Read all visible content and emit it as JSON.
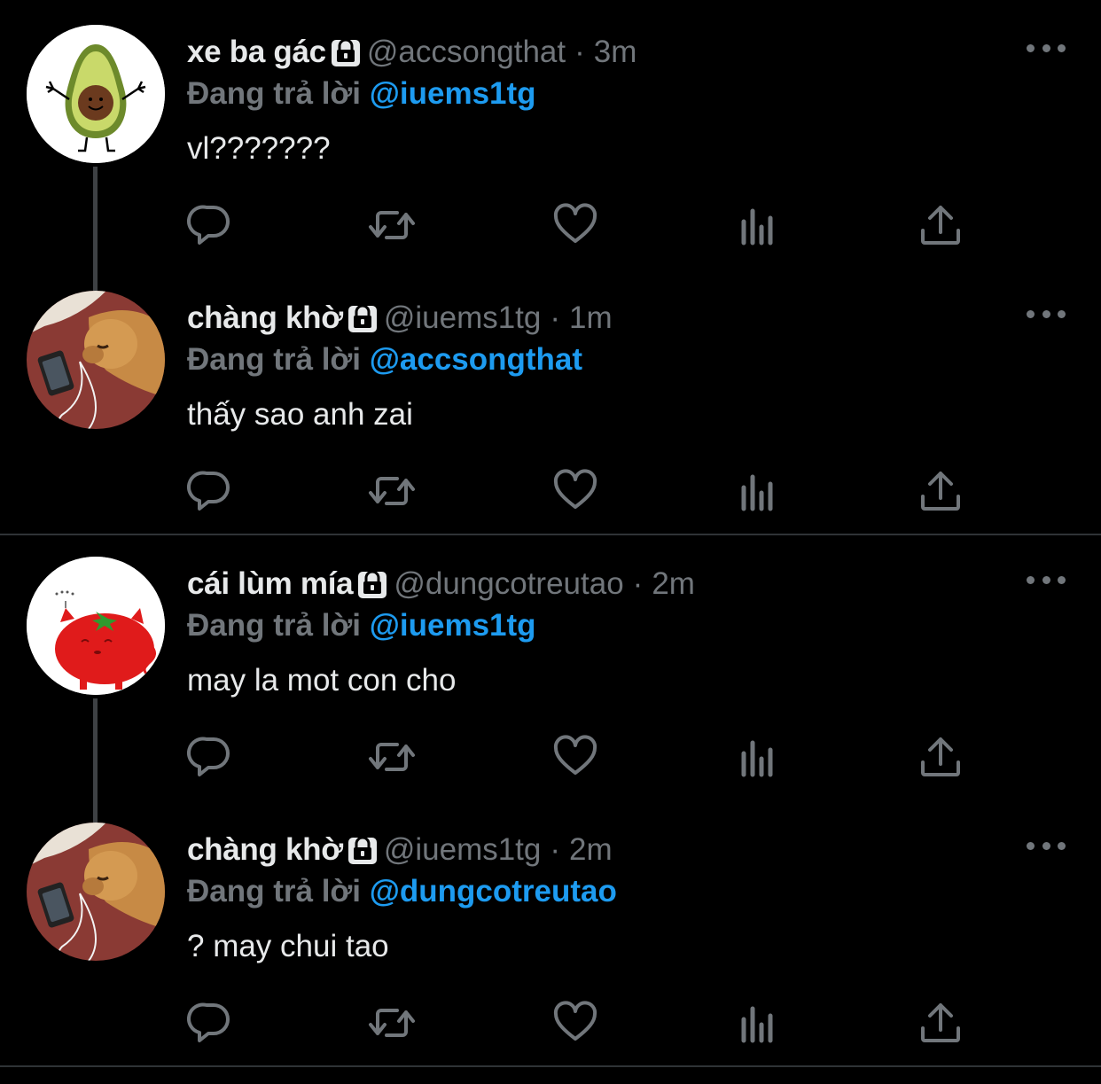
{
  "tweets": [
    {
      "name": "xe ba gác",
      "handle": "@accsongthat",
      "separator": "·",
      "time": "3m",
      "replying_label": "Đang trả lời",
      "replying_to": "@iuems1tg",
      "text": "vl???????",
      "avatar": "avocado-avatar"
    },
    {
      "name": "chàng khờ",
      "handle": "@iuems1tg",
      "separator": "·",
      "time": "1m",
      "replying_label": "Đang trả lời",
      "replying_to": "@accsongthat",
      "text": "thấy sao anh zai",
      "avatar": "dog-avatar"
    },
    {
      "name": "cái lùm mía",
      "handle": "@dungcotreutao",
      "separator": "·",
      "time": "2m",
      "replying_label": "Đang trả lời",
      "replying_to": "@iuems1tg",
      "text": "may la mot con cho",
      "avatar": "tomato-pig-avatar"
    },
    {
      "name": "chàng khờ",
      "handle": "@iuems1tg",
      "separator": "·",
      "time": "2m",
      "replying_label": "Đang trả lời",
      "replying_to": "@dungcotreutao",
      "text": "? may chui tao",
      "avatar": "dog-avatar"
    }
  ],
  "icons": {
    "reply": "reply-icon",
    "retweet": "retweet-icon",
    "like": "like-icon",
    "views": "views-icon",
    "share": "share-icon",
    "more": "more-icon",
    "lock": "lock-icon"
  },
  "colors": {
    "background": "#000000",
    "text": "#e7e9ea",
    "secondary": "#71767b",
    "accent": "#1d9bf0",
    "divider": "#2f3336"
  }
}
